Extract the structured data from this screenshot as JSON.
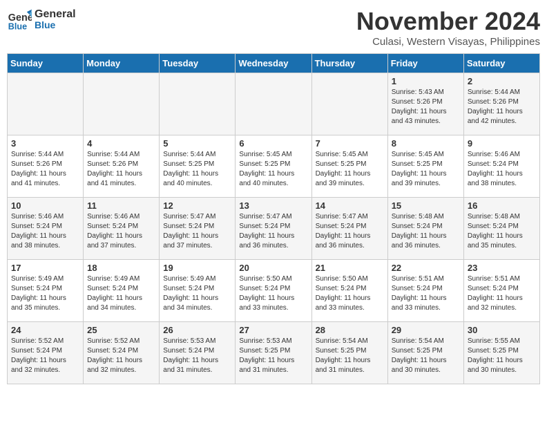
{
  "header": {
    "logo_line1": "General",
    "logo_line2": "Blue",
    "month": "November 2024",
    "location": "Culasi, Western Visayas, Philippines"
  },
  "days_of_week": [
    "Sunday",
    "Monday",
    "Tuesday",
    "Wednesday",
    "Thursday",
    "Friday",
    "Saturday"
  ],
  "weeks": [
    [
      {
        "day": "",
        "info": ""
      },
      {
        "day": "",
        "info": ""
      },
      {
        "day": "",
        "info": ""
      },
      {
        "day": "",
        "info": ""
      },
      {
        "day": "",
        "info": ""
      },
      {
        "day": "1",
        "info": "Sunrise: 5:43 AM\nSunset: 5:26 PM\nDaylight: 11 hours and 43 minutes."
      },
      {
        "day": "2",
        "info": "Sunrise: 5:44 AM\nSunset: 5:26 PM\nDaylight: 11 hours and 42 minutes."
      }
    ],
    [
      {
        "day": "3",
        "info": "Sunrise: 5:44 AM\nSunset: 5:26 PM\nDaylight: 11 hours and 41 minutes."
      },
      {
        "day": "4",
        "info": "Sunrise: 5:44 AM\nSunset: 5:26 PM\nDaylight: 11 hours and 41 minutes."
      },
      {
        "day": "5",
        "info": "Sunrise: 5:44 AM\nSunset: 5:25 PM\nDaylight: 11 hours and 40 minutes."
      },
      {
        "day": "6",
        "info": "Sunrise: 5:45 AM\nSunset: 5:25 PM\nDaylight: 11 hours and 40 minutes."
      },
      {
        "day": "7",
        "info": "Sunrise: 5:45 AM\nSunset: 5:25 PM\nDaylight: 11 hours and 39 minutes."
      },
      {
        "day": "8",
        "info": "Sunrise: 5:45 AM\nSunset: 5:25 PM\nDaylight: 11 hours and 39 minutes."
      },
      {
        "day": "9",
        "info": "Sunrise: 5:46 AM\nSunset: 5:24 PM\nDaylight: 11 hours and 38 minutes."
      }
    ],
    [
      {
        "day": "10",
        "info": "Sunrise: 5:46 AM\nSunset: 5:24 PM\nDaylight: 11 hours and 38 minutes."
      },
      {
        "day": "11",
        "info": "Sunrise: 5:46 AM\nSunset: 5:24 PM\nDaylight: 11 hours and 37 minutes."
      },
      {
        "day": "12",
        "info": "Sunrise: 5:47 AM\nSunset: 5:24 PM\nDaylight: 11 hours and 37 minutes."
      },
      {
        "day": "13",
        "info": "Sunrise: 5:47 AM\nSunset: 5:24 PM\nDaylight: 11 hours and 36 minutes."
      },
      {
        "day": "14",
        "info": "Sunrise: 5:47 AM\nSunset: 5:24 PM\nDaylight: 11 hours and 36 minutes."
      },
      {
        "day": "15",
        "info": "Sunrise: 5:48 AM\nSunset: 5:24 PM\nDaylight: 11 hours and 36 minutes."
      },
      {
        "day": "16",
        "info": "Sunrise: 5:48 AM\nSunset: 5:24 PM\nDaylight: 11 hours and 35 minutes."
      }
    ],
    [
      {
        "day": "17",
        "info": "Sunrise: 5:49 AM\nSunset: 5:24 PM\nDaylight: 11 hours and 35 minutes."
      },
      {
        "day": "18",
        "info": "Sunrise: 5:49 AM\nSunset: 5:24 PM\nDaylight: 11 hours and 34 minutes."
      },
      {
        "day": "19",
        "info": "Sunrise: 5:49 AM\nSunset: 5:24 PM\nDaylight: 11 hours and 34 minutes."
      },
      {
        "day": "20",
        "info": "Sunrise: 5:50 AM\nSunset: 5:24 PM\nDaylight: 11 hours and 33 minutes."
      },
      {
        "day": "21",
        "info": "Sunrise: 5:50 AM\nSunset: 5:24 PM\nDaylight: 11 hours and 33 minutes."
      },
      {
        "day": "22",
        "info": "Sunrise: 5:51 AM\nSunset: 5:24 PM\nDaylight: 11 hours and 33 minutes."
      },
      {
        "day": "23",
        "info": "Sunrise: 5:51 AM\nSunset: 5:24 PM\nDaylight: 11 hours and 32 minutes."
      }
    ],
    [
      {
        "day": "24",
        "info": "Sunrise: 5:52 AM\nSunset: 5:24 PM\nDaylight: 11 hours and 32 minutes."
      },
      {
        "day": "25",
        "info": "Sunrise: 5:52 AM\nSunset: 5:24 PM\nDaylight: 11 hours and 32 minutes."
      },
      {
        "day": "26",
        "info": "Sunrise: 5:53 AM\nSunset: 5:24 PM\nDaylight: 11 hours and 31 minutes."
      },
      {
        "day": "27",
        "info": "Sunrise: 5:53 AM\nSunset: 5:25 PM\nDaylight: 11 hours and 31 minutes."
      },
      {
        "day": "28",
        "info": "Sunrise: 5:54 AM\nSunset: 5:25 PM\nDaylight: 11 hours and 31 minutes."
      },
      {
        "day": "29",
        "info": "Sunrise: 5:54 AM\nSunset: 5:25 PM\nDaylight: 11 hours and 30 minutes."
      },
      {
        "day": "30",
        "info": "Sunrise: 5:55 AM\nSunset: 5:25 PM\nDaylight: 11 hours and 30 minutes."
      }
    ]
  ]
}
